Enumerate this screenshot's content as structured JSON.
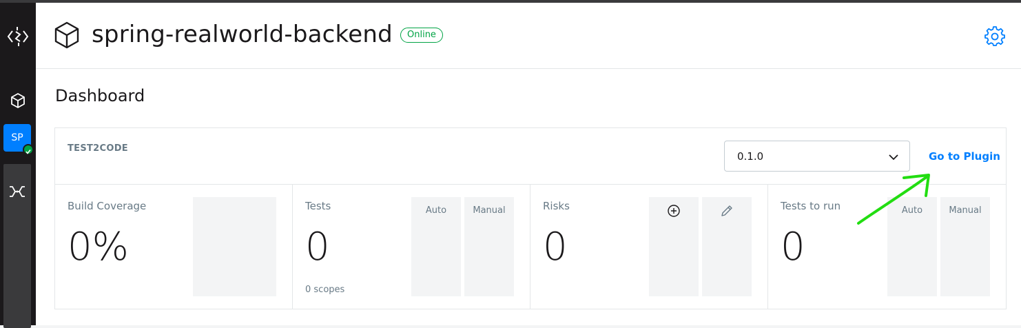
{
  "sidebar": {
    "logo_icon": "drill-logo-icon",
    "nav_icon": "cube-icon",
    "agent_badge": "SP",
    "agent_status_icon": "check-circle-icon",
    "plugin_icon": "test2code-icon"
  },
  "header": {
    "icon": "cube-icon",
    "title": "spring-realworld-backend",
    "status": "Online",
    "settings_icon": "gear-icon"
  },
  "page": {
    "title": "Dashboard"
  },
  "plugin": {
    "name": "TEST2CODE",
    "build_version": "0.1.0",
    "goto_label": "Go to Plugin",
    "metrics": {
      "build_coverage": {
        "label": "Build Coverage",
        "value": "0%"
      },
      "tests": {
        "label": "Tests",
        "value": "0",
        "sub": "0 scopes",
        "auto_label": "Auto",
        "manual_label": "Manual"
      },
      "risks": {
        "label": "Risks",
        "value": "0",
        "new_icon": "plus-circle-icon",
        "modified_icon": "pencil-icon"
      },
      "tests_to_run": {
        "label": "Tests to run",
        "value": "0",
        "auto_label": "Auto",
        "manual_label": "Manual"
      }
    }
  },
  "colors": {
    "accent": "#007fff",
    "online": "#00a344",
    "sidebar": "#1b191b",
    "annotation_arrow": "#22dd11"
  }
}
